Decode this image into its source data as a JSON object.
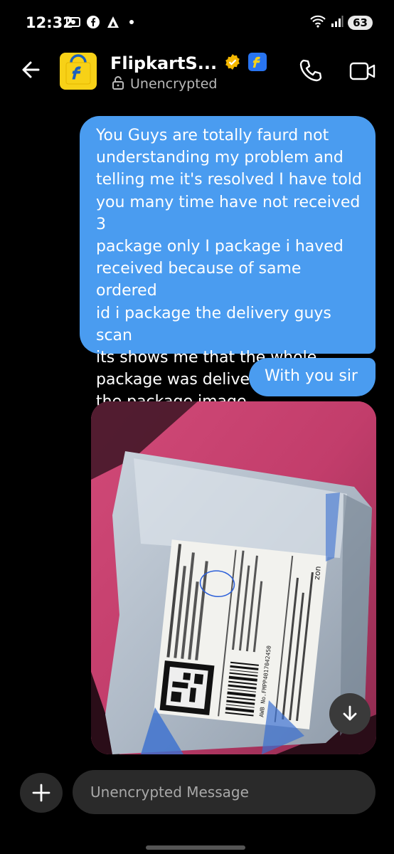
{
  "status_bar": {
    "time": "12:32",
    "battery": "63",
    "icons": [
      "screen-record-icon",
      "facebook-icon",
      "arrow-app-icon",
      "wifi-icon",
      "signal-icon"
    ]
  },
  "header": {
    "title": "FlipkartS...",
    "subtitle": "Unencrypted",
    "verified_badge_color": "#f5b800"
  },
  "messages": [
    {
      "direction": "outgoing",
      "text": "You Guys are totally faurd not understanding my problem and telling me it's resolved I have told you many time have not received 3 package only I package i haved received because of same ordered id i package the delivery guys scan its shows me that the whole package was delivered i will share the package image"
    },
    {
      "direction": "outgoing",
      "text": "With you sir"
    },
    {
      "direction": "incoming",
      "type": "image"
    }
  ],
  "message_lines": [
    "You Guys are totally faurd not",
    "understanding my problem and",
    "telling me it's resolved I have told",
    "you many time have not received 3",
    "package only I package i haved",
    "received because of same ordered",
    "id i package the delivery guys scan",
    "its shows me that the whole",
    "package was delivered i will share",
    "the package image"
  ],
  "photo_label": {
    "awb": "AWB No.FMPP4017042450",
    "tag": "zon"
  },
  "composer": {
    "placeholder": "Unencrypted Message"
  },
  "colors": {
    "bubble": "#4a9cf0",
    "background": "#000000",
    "input": "#2a2a2a"
  }
}
